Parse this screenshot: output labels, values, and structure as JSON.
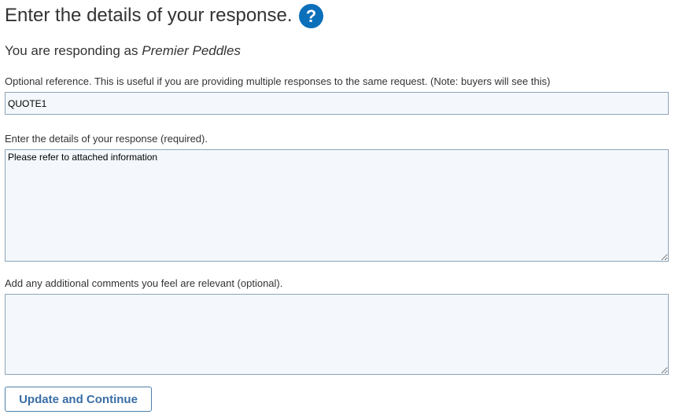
{
  "header": {
    "title": "Enter the details of your response.",
    "help_icon": "question-circle-icon",
    "help_icon_color": "#0b6fba"
  },
  "responder": {
    "prefix": "You are responding as",
    "company": "Premier Peddles"
  },
  "form": {
    "reference": {
      "label": "Optional reference. This is useful if you are providing multiple responses to the same request. (Note: buyers will see this)",
      "value": "QUOTE1"
    },
    "details": {
      "label": "Enter the details of your response (required).",
      "value": "Please refer to attached information"
    },
    "comments": {
      "label": "Add any additional comments you feel are relevant (optional).",
      "value": ""
    },
    "submit_label": "Update and Continue"
  },
  "colors": {
    "field_background": "#f4f8fc",
    "field_border": "#8fa4b8",
    "button_text": "#3a6ea5",
    "button_border": "#4e7fab"
  }
}
